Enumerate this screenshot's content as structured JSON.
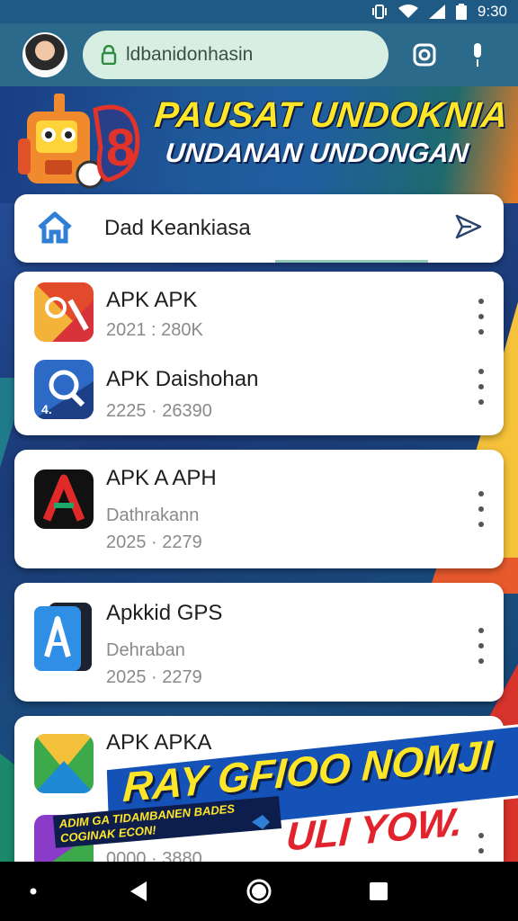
{
  "status_bar": {
    "time": "9:30"
  },
  "browser": {
    "url_text": "ldbanidonhasin"
  },
  "banner": {
    "headline": "PAUSAT UNDOKNIA",
    "subline": "UNDANAN UNDONGAN"
  },
  "header_card": {
    "title": "Dad Keankiasa"
  },
  "apps": [
    {
      "name": "APK APK",
      "line1": "2021 : 280K",
      "line2": ""
    },
    {
      "name": "APK Daishohan",
      "line1": "2225 · 26390",
      "line2": ""
    },
    {
      "name": "APK A APH",
      "line1": "Dathrakann",
      "line2": "2025 · 2279"
    },
    {
      "name": "Apkkid GPS",
      "line1": "Dehraban",
      "line2": "2025 · 2279"
    },
    {
      "name": "APK APKA",
      "line1": "0000 · 3880",
      "line2": ""
    }
  ],
  "promo": {
    "big_text": "RAY GFIOO NOMJI",
    "small_text": "ADIM GA TIDAMBANEN BADES COGINAK ECON!",
    "red_text": "ULI YOW."
  },
  "colors": {
    "accent_blue": "#2f7fd6",
    "banner_yellow": "#ffe628",
    "promo_red": "#e0232c"
  },
  "icons": [
    "wifi-icon",
    "signal-icon",
    "battery-icon",
    "vibrate-icon",
    "lock-icon",
    "camera-icon",
    "mic-icon",
    "home-icon",
    "send-icon",
    "back-icon",
    "home-nav-icon",
    "recents-icon"
  ]
}
